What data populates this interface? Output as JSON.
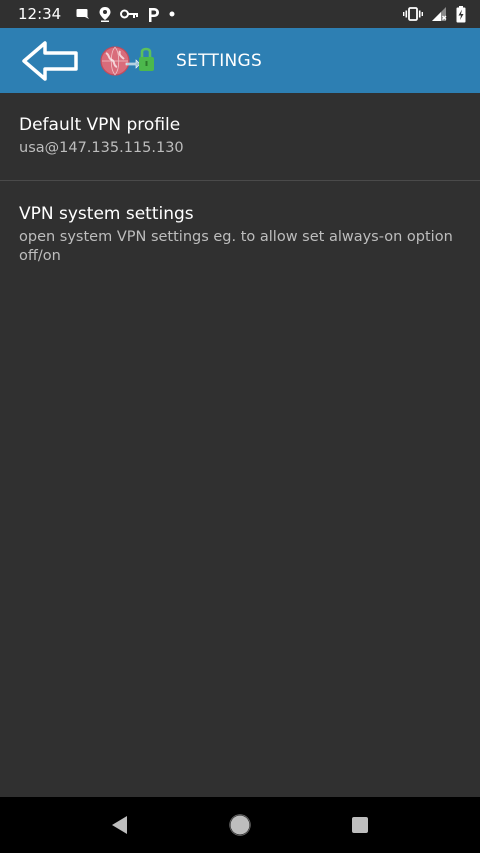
{
  "status_bar": {
    "time": "12:34",
    "left_icons": [
      "notification-message-icon",
      "location-pin-icon",
      "vpn-key-icon",
      "parking-p-icon",
      "dot-icon"
    ],
    "right_icons": [
      "vibrate-icon",
      "signal-icon",
      "battery-charging-icon"
    ]
  },
  "app_bar": {
    "title": "SETTINGS",
    "back_icon": "back-arrow-icon",
    "logo_icon": "vpn-globe-lock-icon",
    "color": "#2d7fb3"
  },
  "settings": [
    {
      "title": "Default VPN profile",
      "summary": "usa@147.135.115.130"
    },
    {
      "title": "VPN system settings",
      "summary": "open system VPN settings eg. to allow set always-on option off/on"
    }
  ],
  "nav_bar": {
    "buttons": [
      "back-triangle-icon",
      "home-circle-icon",
      "recents-square-icon"
    ]
  },
  "colors": {
    "background": "#303030",
    "accent": "#2d7fb3",
    "summary_text": "#bdbdbd",
    "divider": "#4a4a4a"
  }
}
